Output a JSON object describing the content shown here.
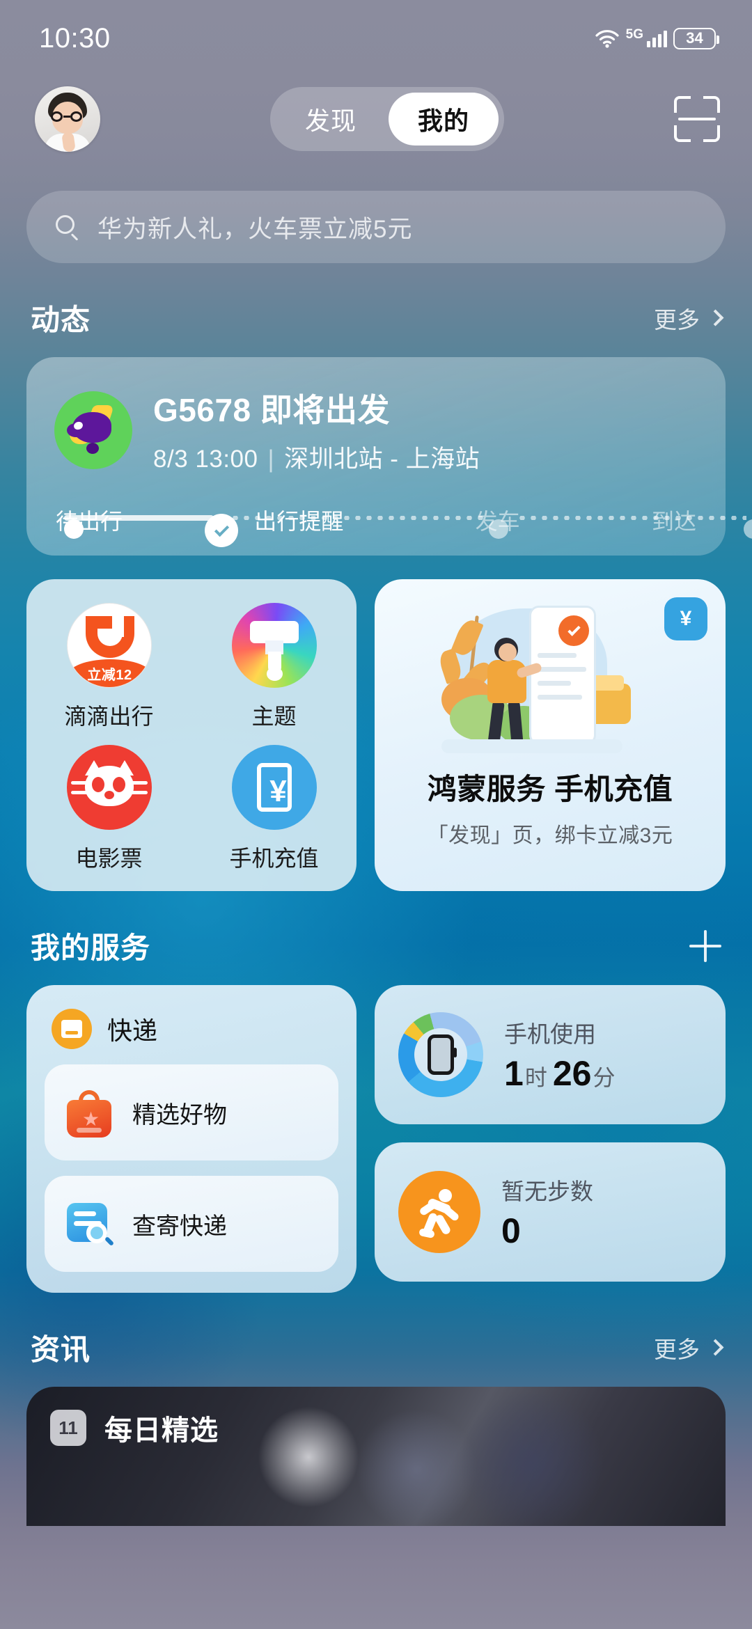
{
  "status_bar": {
    "time": "10:30",
    "network_label": "5G",
    "battery_level": "34"
  },
  "top_nav": {
    "tabs": [
      {
        "label": "发现",
        "active": false
      },
      {
        "label": "我的",
        "active": true
      }
    ],
    "scan_icon": "scan-icon",
    "avatar": "user-avatar"
  },
  "search": {
    "placeholder": "华为新人礼，火车票立减5元",
    "icon": "search-icon"
  },
  "dynamic_section": {
    "title": "动态",
    "more_label": "更多",
    "travel_card": {
      "icon": "airplane-icon",
      "title": "G5678 即将出发",
      "date_time": "8/3 13:00",
      "divider": "|",
      "route": "深圳北站 - 上海站",
      "timeline": [
        {
          "label": "待出行",
          "state": "done"
        },
        {
          "label": "出行提醒",
          "state": "current"
        },
        {
          "label": "发车",
          "state": "pending"
        },
        {
          "label": "到达",
          "state": "pending"
        }
      ]
    }
  },
  "app_grid": [
    {
      "label": "滴滴出行",
      "icon": "didi-icon",
      "badge": "立减12"
    },
    {
      "label": "主题",
      "icon": "theme-brush-icon",
      "badge": ""
    },
    {
      "label": "电影票",
      "icon": "maoyan-cat-icon",
      "badge": ""
    },
    {
      "label": "手机充值",
      "icon": "yen-recharge-icon",
      "badge": ""
    }
  ],
  "promo_card": {
    "badge": "¥",
    "illustration": "person-phone-payment-illustration",
    "title": "鸿蒙服务 手机充值",
    "subtitle": "「发现」页，绑卡立减3元"
  },
  "my_services": {
    "title": "我的服务",
    "add_label": "+",
    "express_card": {
      "icon": "parcel-icon",
      "title": "快递",
      "items": [
        {
          "label": "精选好物",
          "icon": "shopping-bag-icon"
        },
        {
          "label": "查寄快递",
          "icon": "track-parcel-icon"
        }
      ]
    },
    "stats": [
      {
        "icon": "phone-usage-ring-icon",
        "label": "手机使用",
        "value_hours": "1",
        "unit_hours": "时",
        "value_minutes": "26",
        "unit_minutes": "分"
      },
      {
        "icon": "running-person-icon",
        "label": "暂无步数",
        "value": "0"
      }
    ]
  },
  "news_section": {
    "title": "资讯",
    "more_label": "更多",
    "card": {
      "badge": "11",
      "title": "每日精选"
    }
  },
  "colors": {
    "accent_blue": "#0b80b2",
    "didi_orange": "#f4541e",
    "maoyan_red": "#ef3c32",
    "recharge_blue": "#3fa8e6",
    "express_orange": "#f5a623",
    "run_orange": "#f7941d",
    "green_plane_bg": "#5fd25a"
  }
}
